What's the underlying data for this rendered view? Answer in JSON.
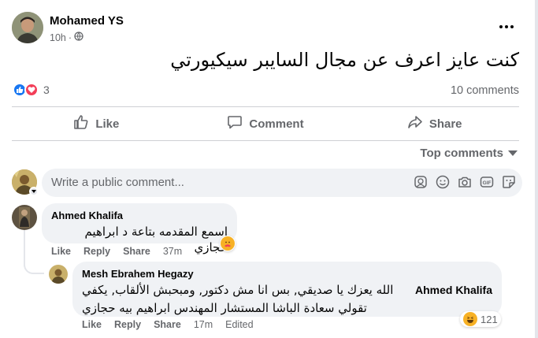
{
  "post": {
    "author": "Mohamed YS",
    "time": "10h",
    "text": "كنت عايز اعرف عن مجال السايبر سيكيورتي",
    "reaction_count": "3",
    "comments_count": "10 comments"
  },
  "actions": {
    "like": "Like",
    "comment": "Comment",
    "share": "Share"
  },
  "sort": {
    "label": "Top comments"
  },
  "composer": {
    "placeholder": "Write a public comment..."
  },
  "comments": [
    {
      "author": "Ahmed Khalifa",
      "text": "اسمع المقدمه بتاعة د ابراهيم حجازي",
      "like": "Like",
      "reply": "Reply",
      "share": "Share",
      "time": "37m"
    },
    {
      "author": "Mesh Ebrahem Hegazy",
      "mention": "Ahmed Khalifa",
      "text_line1": "الله يعزك يا صديقي, بس انا مش دكتور, ومبحبش الألقاب, يكفي",
      "text_line2": "تقولي سعادة الباشا المستشار المهندس ابراهيم بيه حجازي",
      "like": "Like",
      "reply": "Reply",
      "share": "Share",
      "time": "17m",
      "edited": "Edited",
      "reaction_count": "121"
    }
  ],
  "colors": {
    "like_blue": "#1877f2",
    "love_red": "#f33e58",
    "muted_text": "#65676b",
    "bubble_bg": "#f0f2f5"
  }
}
